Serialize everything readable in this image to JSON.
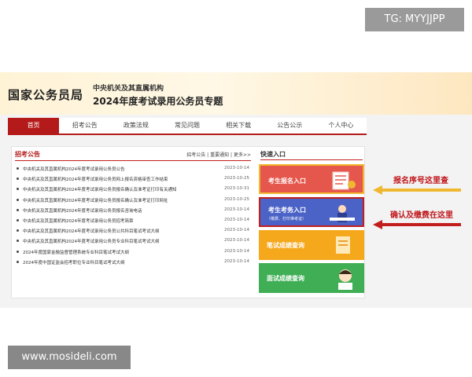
{
  "watermarks": {
    "top": "TG: MYYJJPP",
    "bottom": "www.mosideli.com"
  },
  "banner": {
    "title": "国家公务员局",
    "subtitle1": "中央机关及其直属机构",
    "subtitle2": "2024年度考试录用公务员专题"
  },
  "nav": {
    "items": [
      "首页",
      "招考公告",
      "政策法规",
      "常见问题",
      "相关下载",
      "公告公示",
      "个人中心"
    ],
    "active_index": 0
  },
  "notice": {
    "title": "招考公告",
    "links": "招考公告 | 重要通知 | 更多>>",
    "rows": [
      {
        "text": "中央机关及其直属机构2024年度考试录用公务员公告",
        "date": "2023-10-14"
      },
      {
        "text": "中央机关及其直属机构2024年度考试录用公务员网上报名资格审查工作结束",
        "date": "2023-10-25"
      },
      {
        "text": "中央机关及其直属机构2024年度考试录用公务员报名确认及准考证打印有关通知",
        "date": "2023-10-31"
      },
      {
        "text": "中央机关及其直属机构2024年度考试录用公务员报名确认及准考证打印网址",
        "date": "2023-10-25"
      },
      {
        "text": "中央机关及其直属机构2024年度考试录用公务员报名咨询电话",
        "date": "2023-10-14"
      },
      {
        "text": "中央机关及其直属机构2024年度考试录用公务员招考简章",
        "date": "2023-10-14"
      },
      {
        "text": "中央机关及其直属机构2024年度考试录用公务员公共科目笔试考试大纲",
        "date": "2023-10-14"
      },
      {
        "text": "中央机关及其直属机构2024年度考试录用公务员专业科目笔试考试大纲",
        "date": "2023-10-14"
      },
      {
        "text": "2024年度国家金融监督管理系统专业科目笔试考试大纲",
        "date": "2023-10-14"
      },
      {
        "text": "2024年度中国证监会招考职位专业科目笔试考试大纲",
        "date": "2023-10-14"
      }
    ]
  },
  "quick": {
    "title": "快速入口",
    "buttons": [
      {
        "label": "考生报名入口",
        "sublabel": "",
        "color": "#e5574c"
      },
      {
        "label": "考生考务入口",
        "sublabel": "（缴费、打印准考证）",
        "color": "#4b63c6"
      },
      {
        "label": "笔试成绩查询",
        "sublabel": "",
        "color": "#f5a81c"
      },
      {
        "label": "面试成绩查询",
        "sublabel": "",
        "color": "#3fae55"
      }
    ]
  },
  "annotations": {
    "a1": "报名序号这里查",
    "a2": "确认及缴费在这里"
  },
  "colors": {
    "brand_red": "#b51a1a",
    "annotation_red": "#c0161a"
  }
}
